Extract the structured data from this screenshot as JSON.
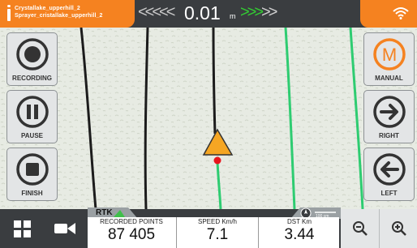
{
  "header": {
    "field_name": "Crystallake_upperhill_2",
    "implement_name": "Sprayer_cristallake_upperhill_2",
    "offset_value": "0.01",
    "offset_unit": "m",
    "left_chevrons": "<<<<<",
    "right_chevrons_active": ">>>",
    "right_chevrons_inactive": ">>"
  },
  "left_panel": {
    "recording_label": "RECORDING",
    "pause_label": "PAUSE",
    "finish_label": "FINISH"
  },
  "right_panel": {
    "manual_label": "MANUAL",
    "manual_letter": "M",
    "right_label": "RIGHT",
    "left_label": "LEFT"
  },
  "status": {
    "rtk_label": "RTK",
    "scale_label": "100 cm"
  },
  "stats": {
    "points_label": "RECORDED POINTS",
    "points_value": "87 405",
    "speed_label": "SPEED Km/h",
    "speed_value": "7.1",
    "dst_label": "DST Km",
    "dst_value": "3.44"
  },
  "icons": {
    "wifi": "wifi-icon",
    "grid": "grid-icon",
    "camera": "camera-icon",
    "zoom_out": "zoom-out-icon",
    "zoom_in": "zoom-in-icon",
    "compass": "compass-icon",
    "vehicle": "vehicle-arrow-icon"
  },
  "colors": {
    "accent": "#f58220",
    "active_line": "#2ecc71",
    "guidance_line": "#1c1c1c",
    "bar_bg": "#3a3d40"
  }
}
